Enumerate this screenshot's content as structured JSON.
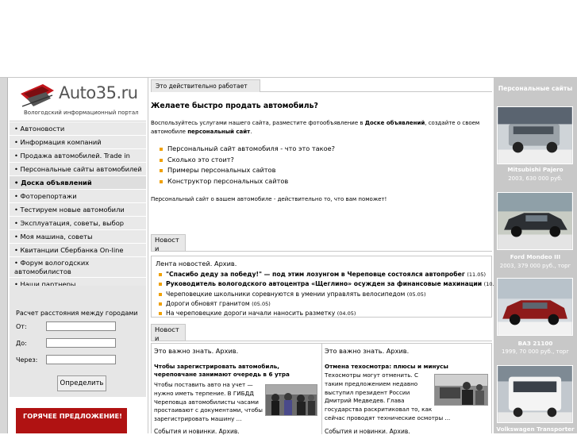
{
  "logo": {
    "text": "Auto35.ru",
    "subtitle": "Вологодский информационный портал"
  },
  "menu": [
    "• Автоновости",
    "• Информация компаний",
    "• Продажа автомобилей. Trade in",
    "• Персональные сайты автомобилей",
    "• Доска объявлений",
    "• Фоторепортажи",
    "• Тестируем новые автомобили",
    "• Эксплуатация, советы, выбор",
    "• Моя машина, советы",
    "• Квитанции Сбербанка On-line",
    "• Форум вологодских автомобилистов",
    "• Наши партнеры"
  ],
  "calc": {
    "title": "Расчет расстояния между городами",
    "from_label": "От:",
    "to_label": "До:",
    "via_label": "Через:",
    "button": "Определить"
  },
  "hot": {
    "label": "ГОРЯЧЕЕ ПРЕДЛОЖЕНИЕ!"
  },
  "center": {
    "tab": "Это действительно работает",
    "heading": "Желаете быстро продать автомобиль?",
    "intro_1": "Воспользуйтесь услугами нашего сайта, разместите фотообъявление в ",
    "intro_link_1": "Доске объявлений",
    "intro_2": ", создайте о своем автомобиле ",
    "intro_link_2": "персональный сайт",
    "intro_3": ".",
    "bullets": [
      "Персональный сайт автомобиля - что это такое?",
      "Сколько это стоит?",
      "Примеры персональных сайтов",
      "Конструктор персональных сайтов"
    ],
    "outro": "Персональный сайт о вашем автомобиле - действительно то, что вам поможет!",
    "news_tab": "Новост и",
    "news_head": "Лента новостей. Архив.",
    "news": [
      {
        "text": "\"Спасибо деду за победу!\" — под этим лозунгом в Череповце состоялся автопробег",
        "date": "(11.05)",
        "bold": true
      },
      {
        "text": "Руководитель вологодского автоцентра «Щеглино» осужден за финансовые махинации",
        "date": "(10.05)",
        "bold": true
      },
      {
        "text": "Череповецкие школьники соревнуются в умении управлять велосипедом",
        "date": "(05.05)",
        "bold": false
      },
      {
        "text": "Дороги обновят гранитом",
        "date": "(05.05)",
        "bold": false
      },
      {
        "text": "На череповецкие дороги начали наносить разметку",
        "date": "(04.05)",
        "bold": false
      }
    ],
    "news_tab2": "Новост и",
    "col1": {
      "head": "Это важно знать. Архив.",
      "title": "Чтобы зарегистрировать автомобиль, череповчане занимают очередь в 6 утра",
      "lines": [
        "Чтобы поставить авто на учет —",
        "нужно иметь терпение. В ГИБДД",
        "Череповца автомобилисты часами",
        "простаивают с документами, чтобы",
        "зарегистрировать машину ..."
      ],
      "foot": "События и новинки. Архив."
    },
    "col2": {
      "head": "Это важно знать. Архив.",
      "title": "Отмена техосмотра: плюсы и минусы",
      "lines": [
        "Техосмотры могут отменить. С",
        "таким предложением недавно",
        "выступил президент России",
        "Дмитрий Медведев. Глава",
        "государства раскритиковал то, как",
        "сейчас проводят технические осмотры ..."
      ],
      "foot": "События и новинки. Архив."
    }
  },
  "right": {
    "head": "Персональные сайты",
    "cars": [
      {
        "name": "Mitsubishi Pajero",
        "info": "2003, 630 000 руб."
      },
      {
        "name": "Ford Mondeo III",
        "info": "2003, 379 000 руб., торг"
      },
      {
        "name": "ВАЗ 21100",
        "info": "1999, 70 000 руб., торг"
      },
      {
        "name": "Volkswagen Transporter",
        "info": ""
      }
    ]
  }
}
